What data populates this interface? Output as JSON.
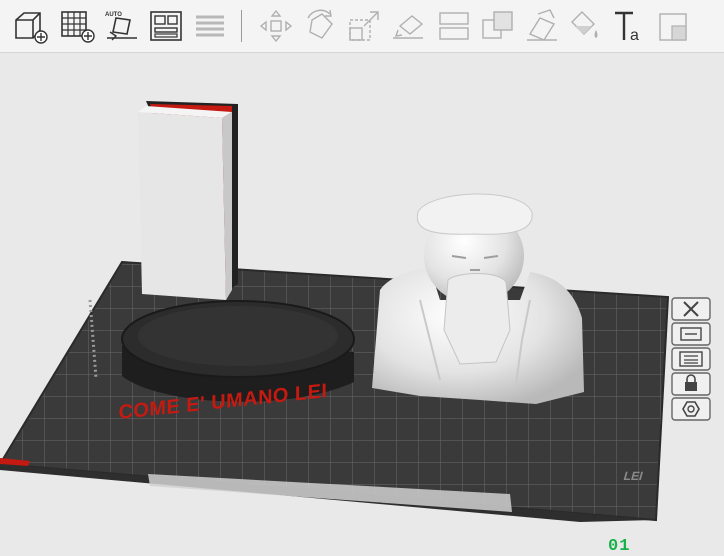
{
  "toolbar": {
    "buttons": [
      {
        "name": "add-object-button",
        "icon": "cube-plus-icon"
      },
      {
        "name": "add-plate-button",
        "icon": "grid-plus-icon"
      },
      {
        "name": "auto-orient-button",
        "icon": "auto-orient-icon",
        "label": "AUTO"
      },
      {
        "name": "arrange-button",
        "icon": "arrange-icon"
      },
      {
        "name": "split-layers-button",
        "icon": "layers-icon"
      },
      {
        "name": "move-button",
        "icon": "move-arrows-icon"
      },
      {
        "name": "rotate-button",
        "icon": "rotate-icon"
      },
      {
        "name": "scale-button",
        "icon": "scale-icon"
      },
      {
        "name": "lay-on-face-button",
        "icon": "lay-on-face-icon"
      },
      {
        "name": "cut-button",
        "icon": "cut-icon"
      },
      {
        "name": "boolean-button",
        "icon": "boolean-icon"
      },
      {
        "name": "support-paint-button",
        "icon": "support-paint-icon"
      },
      {
        "name": "color-paint-button",
        "icon": "color-paint-icon"
      },
      {
        "name": "text-button",
        "icon": "text-icon",
        "label": "Ta"
      },
      {
        "name": "more-tools-button",
        "icon": "more-tools-icon"
      }
    ]
  },
  "plate": {
    "number": "01",
    "name_label": "LEI",
    "side_buttons": [
      {
        "name": "delete-plate-button",
        "icon": "close-icon"
      },
      {
        "name": "arrange-plate-button",
        "icon": "arrange-plate-icon"
      },
      {
        "name": "orient-plate-button",
        "icon": "orient-plate-icon"
      },
      {
        "name": "lock-plate-button",
        "icon": "lock-icon"
      },
      {
        "name": "plate-settings-button",
        "icon": "gear-icon"
      }
    ]
  },
  "objects": {
    "base_text": "COME E' UMANO LEI"
  },
  "colors": {
    "accent_red": "#c41a12",
    "plate_number_green": "#17b14a",
    "bed_dark": "#3a3a3a"
  }
}
